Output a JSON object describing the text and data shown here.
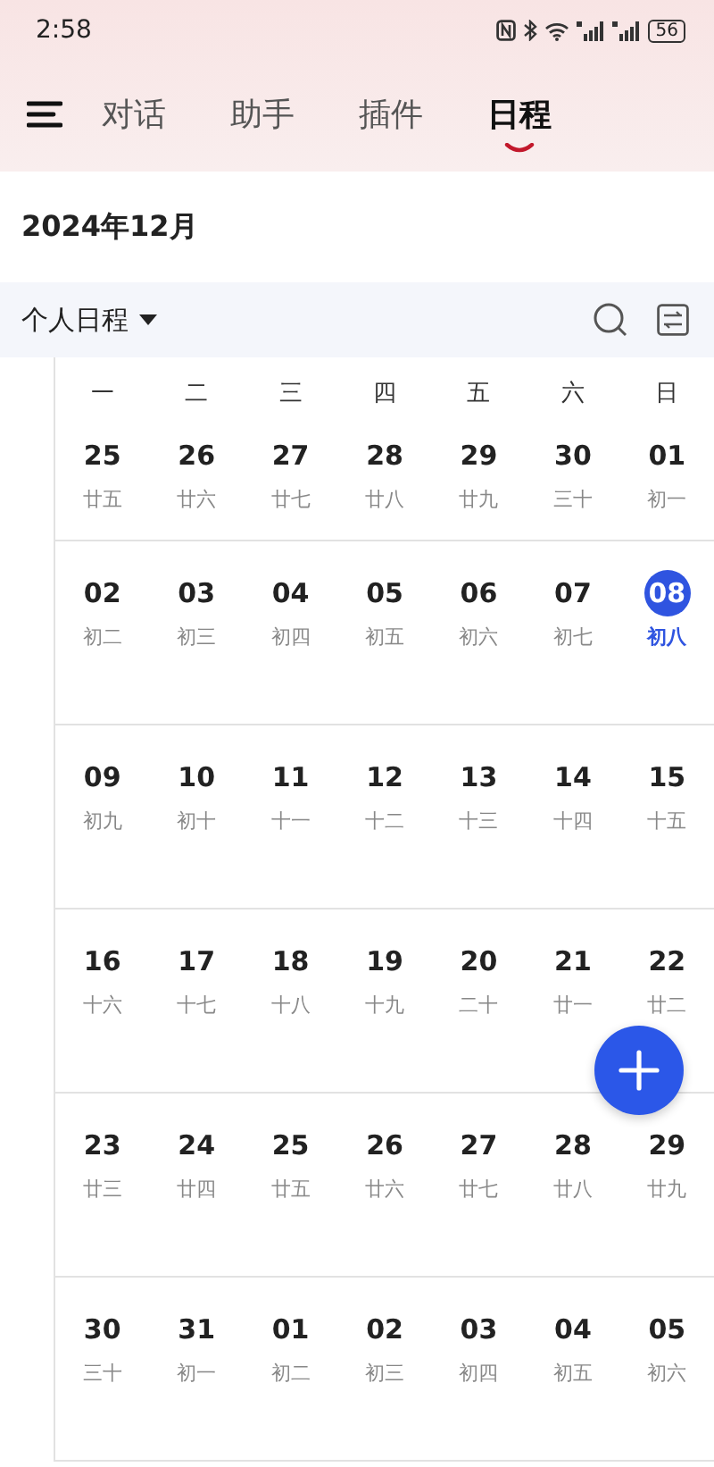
{
  "status_bar": {
    "time": "2:58",
    "battery": "56"
  },
  "tabs": [
    {
      "label": "对话",
      "selected": false
    },
    {
      "label": "助手",
      "selected": false
    },
    {
      "label": "插件",
      "selected": false
    },
    {
      "label": "日程",
      "selected": true
    }
  ],
  "month_title": "2024年12月",
  "calendar_filter": {
    "label": "个人日程"
  },
  "weekdays": [
    "一",
    "二",
    "三",
    "四",
    "五",
    "六",
    "日"
  ],
  "weeks": [
    {
      "days": [
        {
          "date": "25",
          "lunar": "廿五",
          "selected": false
        },
        {
          "date": "26",
          "lunar": "廿六",
          "selected": false
        },
        {
          "date": "27",
          "lunar": "廿七",
          "selected": false
        },
        {
          "date": "28",
          "lunar": "廿八",
          "selected": false
        },
        {
          "date": "29",
          "lunar": "廿九",
          "selected": false
        },
        {
          "date": "30",
          "lunar": "三十",
          "selected": false
        },
        {
          "date": "01",
          "lunar": "初一",
          "selected": false
        }
      ]
    },
    {
      "days": [
        {
          "date": "02",
          "lunar": "初二",
          "selected": false
        },
        {
          "date": "03",
          "lunar": "初三",
          "selected": false
        },
        {
          "date": "04",
          "lunar": "初四",
          "selected": false
        },
        {
          "date": "05",
          "lunar": "初五",
          "selected": false
        },
        {
          "date": "06",
          "lunar": "初六",
          "selected": false
        },
        {
          "date": "07",
          "lunar": "初七",
          "selected": false
        },
        {
          "date": "08",
          "lunar": "初八",
          "selected": true
        }
      ]
    },
    {
      "days": [
        {
          "date": "09",
          "lunar": "初九",
          "selected": false
        },
        {
          "date": "10",
          "lunar": "初十",
          "selected": false
        },
        {
          "date": "11",
          "lunar": "十一",
          "selected": false
        },
        {
          "date": "12",
          "lunar": "十二",
          "selected": false
        },
        {
          "date": "13",
          "lunar": "十三",
          "selected": false
        },
        {
          "date": "14",
          "lunar": "十四",
          "selected": false
        },
        {
          "date": "15",
          "lunar": "十五",
          "selected": false
        }
      ]
    },
    {
      "days": [
        {
          "date": "16",
          "lunar": "十六",
          "selected": false
        },
        {
          "date": "17",
          "lunar": "十七",
          "selected": false
        },
        {
          "date": "18",
          "lunar": "十八",
          "selected": false
        },
        {
          "date": "19",
          "lunar": "十九",
          "selected": false
        },
        {
          "date": "20",
          "lunar": "二十",
          "selected": false
        },
        {
          "date": "21",
          "lunar": "廿一",
          "selected": false
        },
        {
          "date": "22",
          "lunar": "廿二",
          "selected": false
        }
      ]
    },
    {
      "days": [
        {
          "date": "23",
          "lunar": "廿三",
          "selected": false
        },
        {
          "date": "24",
          "lunar": "廿四",
          "selected": false
        },
        {
          "date": "25",
          "lunar": "廿五",
          "selected": false
        },
        {
          "date": "26",
          "lunar": "廿六",
          "selected": false
        },
        {
          "date": "27",
          "lunar": "廿七",
          "selected": false
        },
        {
          "date": "28",
          "lunar": "廿八",
          "selected": false
        },
        {
          "date": "29",
          "lunar": "廿九",
          "selected": false
        }
      ]
    },
    {
      "days": [
        {
          "date": "30",
          "lunar": "三十",
          "selected": false
        },
        {
          "date": "31",
          "lunar": "初一",
          "selected": false
        },
        {
          "date": "01",
          "lunar": "初二",
          "selected": false
        },
        {
          "date": "02",
          "lunar": "初三",
          "selected": false
        },
        {
          "date": "03",
          "lunar": "初四",
          "selected": false
        },
        {
          "date": "04",
          "lunar": "初五",
          "selected": false
        },
        {
          "date": "05",
          "lunar": "初六",
          "selected": false
        }
      ]
    }
  ]
}
